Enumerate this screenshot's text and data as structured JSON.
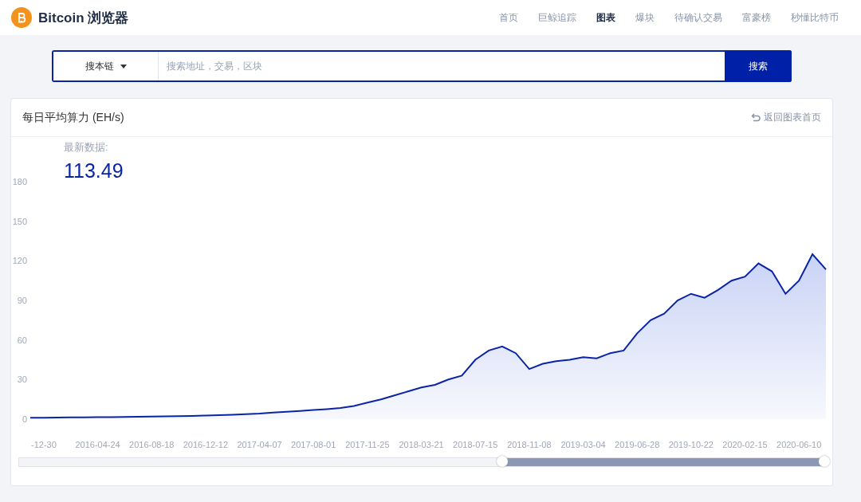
{
  "header": {
    "brand": "Bitcoin 浏览器",
    "nav": [
      {
        "label": "首页",
        "selected": false
      },
      {
        "label": "巨鲸追踪",
        "selected": false
      },
      {
        "label": "图表",
        "selected": true
      },
      {
        "label": "爆块",
        "selected": false
      },
      {
        "label": "待确认交易",
        "selected": false
      },
      {
        "label": "富豪榜",
        "selected": false
      },
      {
        "label": "秒懂比特币",
        "selected": false
      }
    ]
  },
  "search": {
    "scope": "搜本链",
    "placeholder": "搜索地址，交易，区块",
    "button": "搜索"
  },
  "card": {
    "title": "每日平均算力 (EH/s)",
    "back_link": "返回图表首页",
    "latest_label": "最新数据:",
    "latest_value": "113.49",
    "chart_data": {
      "type": "area",
      "ylim": [
        0,
        180
      ],
      "yticks": [
        0,
        30,
        60,
        90,
        120,
        150,
        180
      ],
      "categories": [
        null,
        "-12-30",
        null,
        null,
        null,
        "2016-04-24",
        null,
        null,
        null,
        "2016-08-18",
        null,
        null,
        null,
        "2016-12-12",
        null,
        null,
        null,
        "2017-04-07",
        null,
        null,
        null,
        "2017-08-01",
        null,
        null,
        null,
        "2017-11-25",
        null,
        null,
        null,
        "2018-03-21",
        null,
        null,
        null,
        "2018-07-15",
        null,
        null,
        null,
        "2018-11-08",
        null,
        null,
        null,
        "2019-03-04",
        null,
        null,
        null,
        "2019-06-28",
        null,
        null,
        null,
        "2019-10-22",
        null,
        null,
        null,
        "2020-02-15",
        null,
        null,
        null,
        "2020-06-10",
        null,
        null
      ],
      "series": [
        {
          "color": "#0a24a8",
          "values": [
            1.0,
            1.1,
            1.2,
            1.3,
            1.4,
            1.5,
            1.6,
            1.7,
            1.9,
            2.0,
            2.1,
            2.3,
            2.5,
            2.8,
            3.1,
            3.4,
            3.8,
            4.3,
            5.0,
            5.6,
            6.2,
            6.9,
            7.6,
            8.5,
            10.0,
            12.5,
            15,
            18,
            21,
            24,
            26,
            30,
            33,
            45,
            52,
            55,
            50,
            38,
            42,
            44,
            45,
            47,
            46,
            50,
            52,
            65,
            75,
            80,
            90,
            95,
            92,
            98,
            105,
            108,
            118,
            112,
            95,
            105,
            125,
            113.49
          ]
        }
      ]
    },
    "zoom_slider": {
      "start": {
        "level": 0.6
      },
      "end": {
        "level": 1.0
      }
    }
  }
}
